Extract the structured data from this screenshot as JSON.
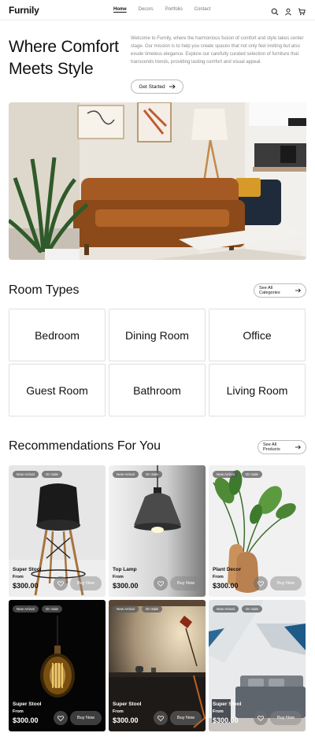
{
  "brand": "Furnily",
  "nav": {
    "links": [
      {
        "label": "Home",
        "active": true
      },
      {
        "label": "Decors",
        "active": false
      },
      {
        "label": "Portfolio",
        "active": false
      },
      {
        "label": "Contact",
        "active": false
      }
    ],
    "icons": [
      "search-icon",
      "user-icon",
      "cart-icon"
    ]
  },
  "hero": {
    "title_line1": "Where Comfort",
    "title_line2": "Meets Style",
    "description": "Welcome to Furnily, where the harmonious fusion of comfort and style takes center stage. Our mission is to help you create spaces that not only feel inviting but also exude timeless elegance. Explore our carefully curated selection of furniture that transcends trends, providing lasting comfort and visual appeal.",
    "cta_label": "Get Started"
  },
  "room_types": {
    "title": "Room Types",
    "button_label": "See All Categories",
    "items": [
      "Bedroom",
      "Dining Room",
      "Office",
      "Guest Room",
      "Bathroom",
      "Living Room"
    ]
  },
  "recommendations": {
    "title": "Recommendations For You",
    "button_label": "See All Products",
    "badge_new": "New Arrival",
    "badge_sale": "On Sale",
    "from_label": "From",
    "buy_label": "Buy Now",
    "products": [
      {
        "name": "Super Stool",
        "price": "$300.00",
        "image": "black-stool",
        "theme": "light"
      },
      {
        "name": "Top Lamp",
        "price": "$300.00",
        "image": "pendant-lamp",
        "theme": "light"
      },
      {
        "name": "Plant Decor",
        "price": "$300.00",
        "image": "potted-plant",
        "theme": "light"
      },
      {
        "name": "Super Stool",
        "price": "$300.00",
        "image": "edison-bulb",
        "theme": "dark"
      },
      {
        "name": "Super Stool",
        "price": "$300.00",
        "image": "desk-lamp-room",
        "theme": "dark"
      },
      {
        "name": "Super Stool",
        "price": "$300.00",
        "image": "bedroom-scene",
        "theme": "dark"
      }
    ]
  },
  "colors": {
    "text": "#111111",
    "muted": "#888888",
    "border": "#e0e0e0",
    "badge": "#5a5a5a"
  }
}
